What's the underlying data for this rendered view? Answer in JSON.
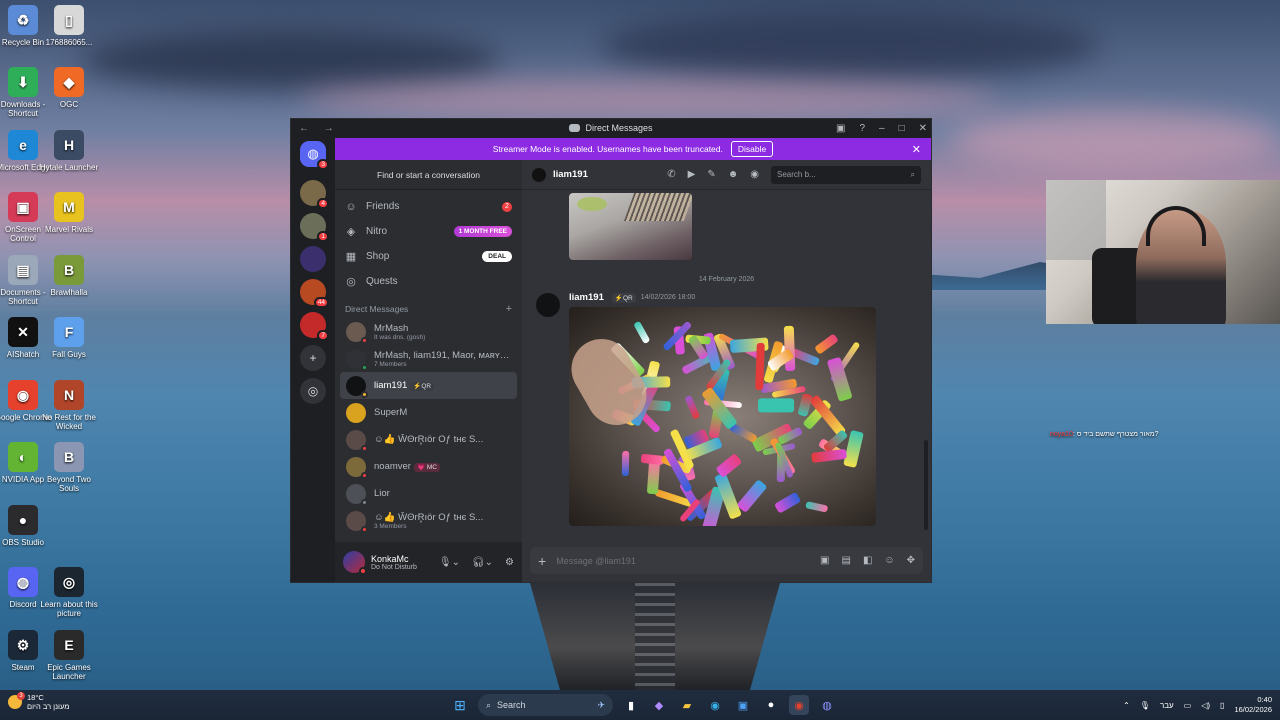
{
  "desktop": {
    "icons": [
      {
        "label": "Recycle Bin",
        "icon": "recycle-bin-icon",
        "color": "#5b8bd6",
        "glyph": "♻"
      },
      {
        "label": "176886065...",
        "icon": "file-icon",
        "color": "#d8d8d8",
        "glyph": "▯"
      },
      {
        "label": "Downloads - Shortcut",
        "icon": "downloads-folder-icon",
        "color": "#2fae5a",
        "glyph": "⬇"
      },
      {
        "label": "OGC",
        "icon": "ogc-app-icon",
        "color": "#f06a25",
        "glyph": "◆"
      },
      {
        "label": "Microsoft Edge",
        "icon": "edge-icon",
        "color": "#1e88d6",
        "glyph": "e"
      },
      {
        "label": "Hytale Launcher",
        "icon": "hytale-icon",
        "color": "#3a4b63",
        "glyph": "H"
      },
      {
        "label": "OnScreen Control",
        "icon": "onscreen-control-icon",
        "color": "#d53b57",
        "glyph": "▣"
      },
      {
        "label": "Marvel Rivals",
        "icon": "marvel-rivals-icon",
        "color": "#e8c21f",
        "glyph": "M"
      },
      {
        "label": "Documents - Shortcut",
        "icon": "documents-icon",
        "color": "#9aa8b9",
        "glyph": "▤"
      },
      {
        "label": "Brawlhalla",
        "icon": "brawlhalla-icon",
        "color": "#7a9a3a",
        "glyph": "B"
      },
      {
        "label": "AIShatch",
        "icon": "aishatch-icon",
        "color": "#111111",
        "glyph": "✕"
      },
      {
        "label": "Fall Guys",
        "icon": "fall-guys-icon",
        "color": "#5fa0ec",
        "glyph": "F"
      },
      {
        "label": "Google Chrome",
        "icon": "chrome-icon",
        "color": "#e5412d",
        "glyph": "◉"
      },
      {
        "label": "No Rest for the Wicked",
        "icon": "no-rest-icon",
        "color": "#b0452a",
        "glyph": "N"
      },
      {
        "label": "NVIDIA App",
        "icon": "nvidia-icon",
        "color": "#62b432",
        "glyph": "◐"
      },
      {
        "label": "Beyond Two Souls",
        "icon": "beyond-two-souls-icon",
        "color": "#8b96b3",
        "glyph": "B"
      },
      {
        "label": "OBS Studio",
        "icon": "obs-icon",
        "color": "#2b2b2e",
        "glyph": "●"
      },
      {
        "label": "Discord",
        "icon": "discord-icon",
        "color": "#5865f2",
        "glyph": "◍"
      },
      {
        "label": "Learn about this picture",
        "icon": "learn-picture-icon",
        "color": "#1c2630",
        "glyph": "◎"
      },
      {
        "label": "Steam",
        "icon": "steam-icon",
        "color": "#1b2838",
        "glyph": "⚙"
      },
      {
        "label": "Epic Games Launcher",
        "icon": "epic-games-icon",
        "color": "#2a2a2a",
        "glyph": "E"
      }
    ]
  },
  "window": {
    "title": "Direct Messages",
    "banner_text": "Streamer Mode is enabled. Usernames have been truncated.",
    "banner_button": "Disable",
    "accent": "#8c2be2"
  },
  "guilds": [
    {
      "badge": "3",
      "kind": "home"
    },
    {
      "badge": "4",
      "color": "#7a6a4a"
    },
    {
      "badge": "1",
      "color": "#6b6f5a"
    },
    {
      "badge": "",
      "color": "#3b2f6e"
    },
    {
      "badge": "44",
      "color": "#b84a22"
    },
    {
      "badge": "7",
      "color": "#c42a2a"
    }
  ],
  "dm_panel": {
    "find_label": "Find or start a conversation",
    "nav": [
      {
        "label": "Friends",
        "icon": "friends-icon",
        "glyph": "☺",
        "right": "2",
        "right_kind": "red"
      },
      {
        "label": "Nitro",
        "icon": "nitro-icon",
        "glyph": "◈",
        "right": "1 MONTH FREE",
        "right_kind": "nitro"
      },
      {
        "label": "Shop",
        "icon": "shop-icon",
        "glyph": "▦",
        "right": "DEAL",
        "right_kind": "deal"
      },
      {
        "label": "Quests",
        "icon": "quests-icon",
        "glyph": "◎",
        "right": "",
        "right_kind": ""
      }
    ],
    "dm_header": "Direct Messages",
    "dms": [
      {
        "name": "MrMash",
        "sub": "It was dns. (gosh)",
        "tag": "",
        "color": "#6a5a4f",
        "status": "#f23f43",
        "active": false
      },
      {
        "name": "MrMash, liam191, Maor, ᴍᴀʀʏ, ...",
        "sub": "7 Members",
        "tag": "",
        "color": "#2f3136",
        "status": "#23a55a",
        "active": false
      },
      {
        "name": "liam191",
        "sub": "",
        "tag": "⚡QR",
        "color": "#111214",
        "status": "#f0b232",
        "active": true
      },
      {
        "name": "SuperM",
        "sub": "",
        "tag": "",
        "color": "#d9a21f",
        "status": "",
        "active": false
      },
      {
        "name": "☺👍 ŴΘrR̥ıör Oƒ tнє S...",
        "sub": "",
        "tag": "",
        "color": "#5a4a48",
        "status": "#f23f43",
        "active": false
      },
      {
        "name": "noamver",
        "sub": "",
        "tag": "💗 MC",
        "color": "#7c6a3a",
        "status": "#f23f43",
        "active": false
      },
      {
        "name": "Lior",
        "sub": "",
        "tag": "",
        "color": "#4e5058",
        "status": "#80848e",
        "active": false
      },
      {
        "name": "☺👍 ŴΘrR̥ıör Oƒ tнє S...",
        "sub": "3 Members",
        "tag": "",
        "color": "#5a4a48",
        "status": "#f23f43",
        "active": false
      }
    ],
    "user": {
      "name": "KonkaMc",
      "status": "Do Not Disturb"
    }
  },
  "chat": {
    "recipient": "liam191",
    "search_placeholder": "Search b...",
    "date_divider": "14 February 2026",
    "message": {
      "author": "liam191",
      "tag": "⚡QR",
      "timestamp": "14/02/2026 18:00"
    },
    "composer_placeholder": "Message @liam191"
  },
  "stream_chat": {
    "user": "noya10",
    "text": ": מאור מצטרף שתשם ביד ס?"
  },
  "taskbar": {
    "weather_temp": "18°C",
    "weather_desc": "מעונן רב היום",
    "weather_badge": "3",
    "search_label": "Search",
    "lang": "עבר",
    "time": "0:40",
    "date": "16/02/2026"
  }
}
